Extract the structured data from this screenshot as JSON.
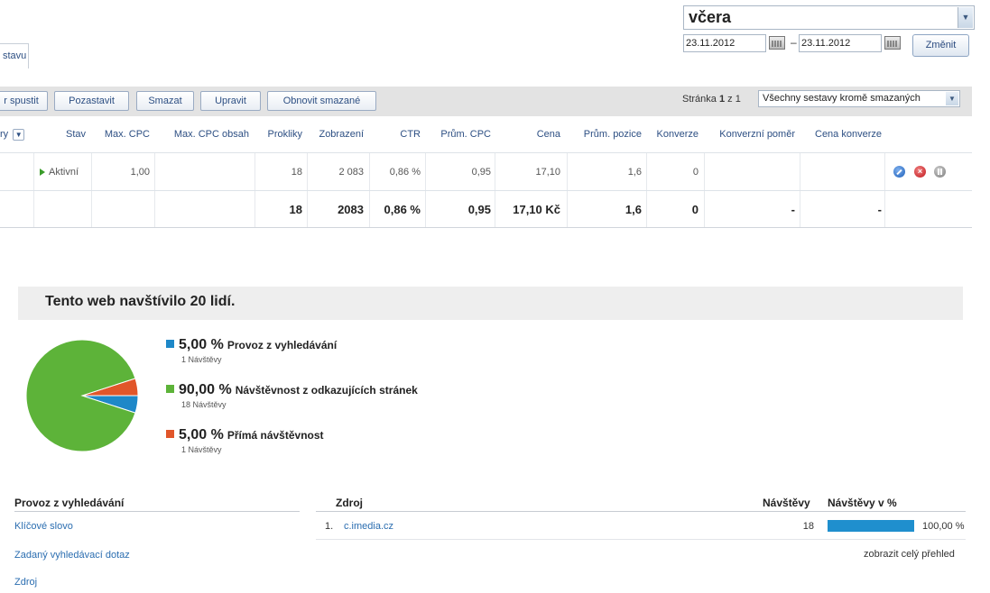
{
  "date": {
    "range_label": "včera",
    "from": "23.11.2012",
    "separator": "–",
    "to": "23.11.2012",
    "change_button": "Změnit"
  },
  "tab_label": "stavu",
  "toolbar": {
    "buttons": [
      "r spustit",
      "Pozastavit",
      "Smazat",
      "Upravit",
      "Obnovit smazané"
    ],
    "page_prefix": "Stránka ",
    "page_current": "1",
    "page_suffix": " z 1",
    "filter_value": "Všechny sestavy kromě smazaných"
  },
  "table": {
    "headers": {
      "name": "ry",
      "status": "Stav",
      "max_cpc": "Max. CPC",
      "max_cpc_content": "Max. CPC obsah",
      "clicks": "Prokliky",
      "impressions": "Zobrazení",
      "ctr": "CTR",
      "avg_cpc": "Prům. CPC",
      "cost": "Cena",
      "avg_position": "Prům. pozice",
      "conversions": "Konverze",
      "conversion_rate": "Konverzní poměr",
      "conversion_cost": "Cena konverze"
    },
    "row": {
      "status": "Aktivní",
      "max_cpc": "1,00",
      "clicks": "18",
      "impressions": "2 083",
      "ctr": "0,86 %",
      "avg_cpc": "0,95",
      "cost": "17,10",
      "avg_position": "1,6",
      "conversions": "0"
    },
    "total": {
      "clicks": "18",
      "impressions": "2083",
      "ctr": "0,86 %",
      "avg_cpc": "0,95",
      "cost": "17,10 Kč",
      "avg_position": "1,6",
      "conversions": "0",
      "conversion_rate": "-",
      "conversion_cost": "-"
    },
    "row_icons": [
      "edit-icon",
      "delete-icon",
      "pause-icon"
    ]
  },
  "analytics": {
    "title": "Tento web navštívilo 20 lidí.",
    "legend": [
      {
        "pct": "5,00 %",
        "label": "Provoz z vyhledávání",
        "sub": "1 Návštěvy",
        "color": "#1e88c8"
      },
      {
        "pct": "90,00 %",
        "label": "Návštěvnost z odkazujících stránek",
        "sub": "18 Návštěvy",
        "color": "#5db339"
      },
      {
        "pct": "5,00 %",
        "label": "Přímá návštěvnost",
        "sub": "1 Návštěvy",
        "color": "#e1562a"
      }
    ],
    "chart_data": {
      "type": "pie",
      "categories": [
        "Provoz z vyhledávání",
        "Návštěvnost z odkazujících stránek",
        "Přímá návštěvnost"
      ],
      "values": [
        5,
        90,
        5
      ],
      "colors": [
        "#1e88c8",
        "#5db339",
        "#e1562a"
      ]
    },
    "search_section": {
      "title": "Provoz z vyhledávání",
      "links": [
        "Klíčové slovo",
        "Zadaný vyhledávací dotaz",
        "Zdroj"
      ]
    },
    "source_table": {
      "col_source": "Zdroj",
      "col_visits": "Návštěvy",
      "col_visits_pct": "Návštěvy v %",
      "rows": [
        {
          "index": "1.",
          "source": "c.imedia.cz",
          "visits": "18",
          "pct_label": "100,00 %",
          "pct_value": 100
        }
      ],
      "full_report_link": "zobrazit celý přehled"
    }
  }
}
